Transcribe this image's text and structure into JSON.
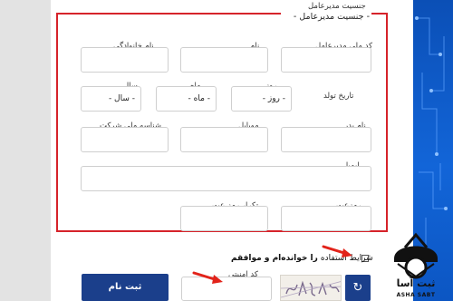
{
  "form": {
    "gender_label": "جنسیت مدیرعامل",
    "gender_selected": "- جنسیت مدیرعامل -",
    "national_code_label": "کد ملی مدیرعامل",
    "first_name_label": "نام",
    "last_name_label": "نام خانوادگی",
    "birth_date_label": "تاریخ تولد",
    "day_label": "روز",
    "day_selected": "- روز -",
    "month_label": "ماه",
    "month_selected": "- ماه -",
    "year_label": "سال",
    "year_selected": "- سال -",
    "father_name_label": "نام پدر",
    "mobile_label": "موبایل",
    "company_id_label": "شناسه ملی شرکت",
    "email_label": "ایمیل",
    "password_label": "رمزعبور",
    "password_repeat_label": "تکرار رمز عبور",
    "terms_prefix": "شرایط استفاده",
    "terms_suffix": " را خوانده‌ام و موافقم",
    "captcha_label": "کد امنیتی",
    "submit_label": "ثبت نام"
  },
  "logo": {
    "name": "ثبت آسا",
    "subtitle": "ASHA SABT"
  },
  "colors": {
    "highlight_frame": "#d6232a",
    "primary_button": "#1b3f8b",
    "annotation_arrow": "#e2231a"
  },
  "icons": [
    "refresh-icon",
    "chevron-down-icon",
    "arrow-icon",
    "logo-icon"
  ]
}
